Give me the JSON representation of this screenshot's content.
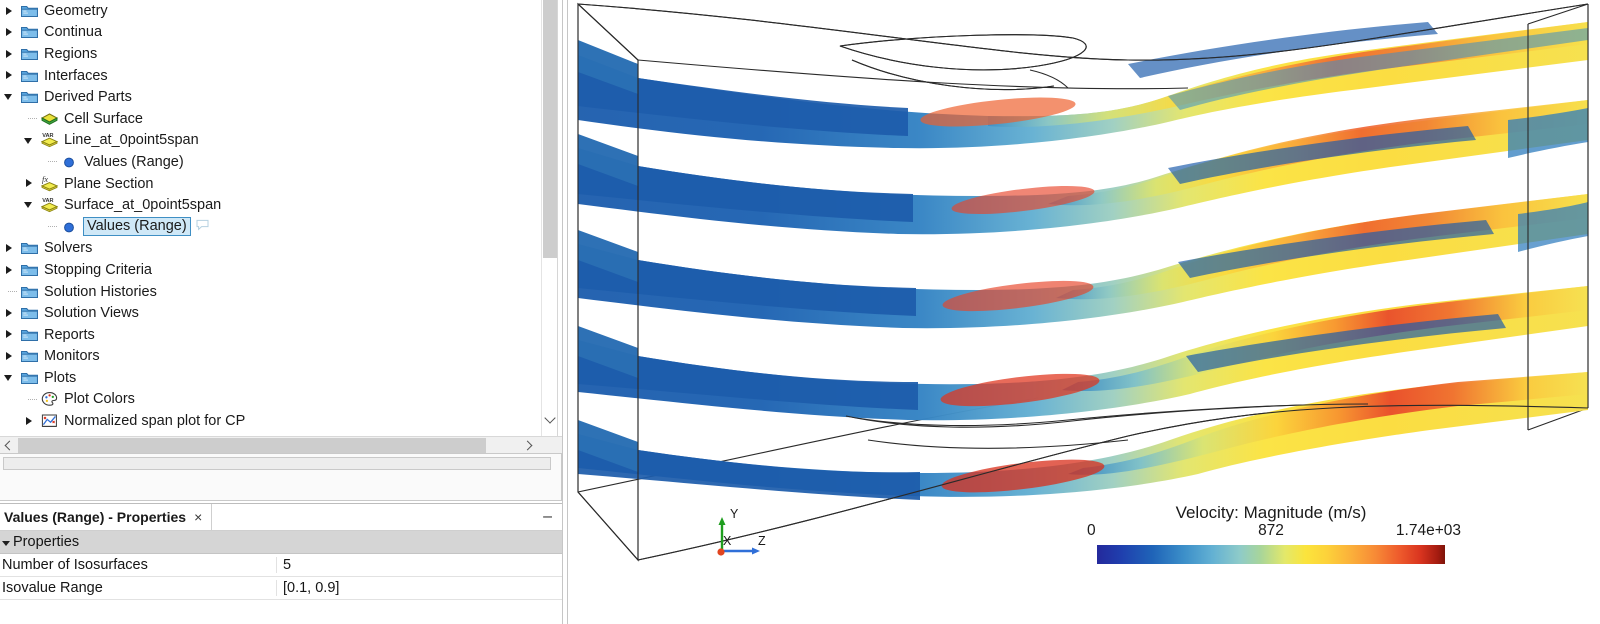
{
  "tree": {
    "items": [
      {
        "label": "Geometry",
        "icon": "folder-icon",
        "state": "closed",
        "indent": 1
      },
      {
        "label": "Continua",
        "icon": "folder-icon",
        "state": "closed",
        "indent": 1
      },
      {
        "label": "Regions",
        "icon": "folder-icon",
        "state": "closed",
        "indent": 1
      },
      {
        "label": "Interfaces",
        "icon": "folder-icon",
        "state": "closed",
        "indent": 1
      },
      {
        "label": "Derived Parts",
        "icon": "folder-icon",
        "state": "open",
        "indent": 1
      },
      {
        "label": "Cell Surface",
        "icon": "cell-surface-icon",
        "state": "none",
        "indent": 2
      },
      {
        "label": "Line_at_0point5span",
        "icon": "var-part-icon",
        "state": "open",
        "indent": 2
      },
      {
        "label": "Values (Range)",
        "icon": "blue-dot-icon",
        "state": "none",
        "indent": 3
      },
      {
        "label": "Plane Section",
        "icon": "fx-part-icon",
        "state": "closed",
        "indent": 2
      },
      {
        "label": "Surface_at_0point5span",
        "icon": "var-part-icon",
        "state": "open",
        "indent": 2
      },
      {
        "label": "Values (Range)",
        "icon": "blue-dot-icon",
        "state": "none",
        "indent": 3,
        "selected": true,
        "has_comment": true
      },
      {
        "label": "Solvers",
        "icon": "folder-icon",
        "state": "closed",
        "indent": 1
      },
      {
        "label": "Stopping Criteria",
        "icon": "folder-icon",
        "state": "closed",
        "indent": 1
      },
      {
        "label": "Solution Histories",
        "icon": "folder-icon",
        "state": "none",
        "indent": 1
      },
      {
        "label": "Solution Views",
        "icon": "folder-icon",
        "state": "closed",
        "indent": 1
      },
      {
        "label": "Reports",
        "icon": "folder-icon",
        "state": "closed",
        "indent": 1
      },
      {
        "label": "Monitors",
        "icon": "folder-icon",
        "state": "closed",
        "indent": 1
      },
      {
        "label": "Plots",
        "icon": "folder-icon",
        "state": "open",
        "indent": 1
      },
      {
        "label": "Plot Colors",
        "icon": "palette-icon",
        "state": "none",
        "indent": 2
      },
      {
        "label": "Normalized span plot for CP",
        "icon": "plot-icon",
        "state": "closed",
        "indent": 2
      }
    ]
  },
  "properties_panel": {
    "tab_title": "Values (Range) - Properties",
    "close_label": "×",
    "minimize_label": "–",
    "group_label": "Properties",
    "rows": [
      {
        "name": "Number of Isosurfaces",
        "value": "5"
      },
      {
        "name": "Isovalue Range",
        "value": "[0.1, 0.9]"
      }
    ]
  },
  "scene": {
    "axis_triad": {
      "x_label": "X",
      "y_label": "Y",
      "z_label": "Z"
    },
    "colorbar": {
      "title": "Velocity: Magnitude (m/s)",
      "min_label": "0",
      "mid_label": "872",
      "max_label": "1.74e+03"
    }
  }
}
